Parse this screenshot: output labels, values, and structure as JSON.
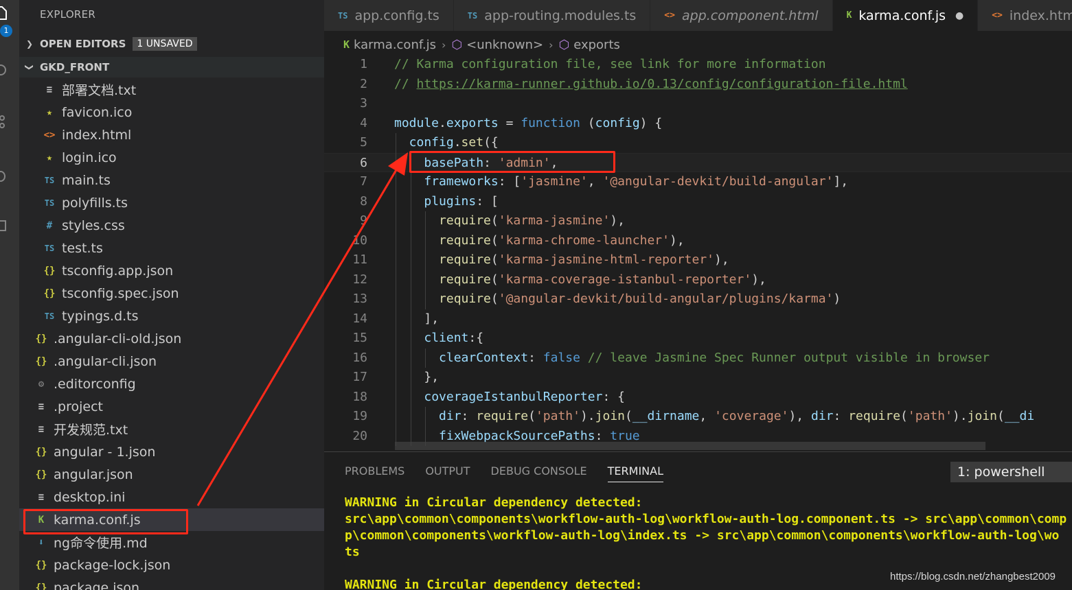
{
  "activity_bar": {
    "badge": "1",
    "icons": [
      "files-icon",
      "search-icon",
      "source-control-icon",
      "debug-icon",
      "extensions-icon"
    ]
  },
  "sidebar": {
    "title": "EXPLORER",
    "open_editors": {
      "label": "OPEN EDITORS",
      "badge": "1 UNSAVED"
    },
    "project": {
      "label": "GKD_FRONT"
    },
    "items": [
      {
        "label": "部署文档.txt",
        "icon": "txt-file-icon",
        "glyph": "≡",
        "type": "txt",
        "indent": 2
      },
      {
        "label": "favicon.ico",
        "icon": "star-file-icon",
        "glyph": "★",
        "type": "star",
        "indent": 2
      },
      {
        "label": "index.html",
        "icon": "html-file-icon",
        "glyph": "<>",
        "type": "html",
        "indent": 2
      },
      {
        "label": "login.ico",
        "icon": "star-file-icon",
        "glyph": "★",
        "type": "star",
        "indent": 2
      },
      {
        "label": "main.ts",
        "icon": "ts-file-icon",
        "glyph": "TS",
        "type": "ts",
        "indent": 2
      },
      {
        "label": "polyfills.ts",
        "icon": "ts-file-icon",
        "glyph": "TS",
        "type": "ts",
        "indent": 2
      },
      {
        "label": "styles.css",
        "icon": "css-file-icon",
        "glyph": "#",
        "type": "css",
        "indent": 2
      },
      {
        "label": "test.ts",
        "icon": "ts-file-icon",
        "glyph": "TS",
        "type": "ts",
        "indent": 2
      },
      {
        "label": "tsconfig.app.json",
        "icon": "json-file-icon",
        "glyph": "{}",
        "type": "json",
        "indent": 2
      },
      {
        "label": "tsconfig.spec.json",
        "icon": "json-file-icon",
        "glyph": "{}",
        "type": "json",
        "indent": 2
      },
      {
        "label": "typings.d.ts",
        "icon": "ts-file-icon",
        "glyph": "TS",
        "type": "ts",
        "indent": 2
      },
      {
        "label": ".angular-cli-old.json",
        "icon": "json-file-icon",
        "glyph": "{}",
        "type": "json",
        "indent": 1
      },
      {
        "label": ".angular-cli.json",
        "icon": "json-file-icon",
        "glyph": "{}",
        "type": "json",
        "indent": 1
      },
      {
        "label": ".editorconfig",
        "icon": "gear-file-icon",
        "glyph": "⚙",
        "type": "gear",
        "indent": 1
      },
      {
        "label": ".project",
        "icon": "txt-file-icon",
        "glyph": "≡",
        "type": "txt",
        "indent": 1
      },
      {
        "label": "开发规范.txt",
        "icon": "txt-file-icon",
        "glyph": "≡",
        "type": "txt",
        "indent": 1
      },
      {
        "label": "angular - 1.json",
        "icon": "json-file-icon",
        "glyph": "{}",
        "type": "json",
        "indent": 1
      },
      {
        "label": "angular.json",
        "icon": "json-file-icon",
        "glyph": "{}",
        "type": "json",
        "indent": 1
      },
      {
        "label": "desktop.ini",
        "icon": "txt-file-icon",
        "glyph": "≡",
        "type": "txt",
        "indent": 1
      },
      {
        "label": "karma.conf.js",
        "icon": "karma-file-icon",
        "glyph": "K",
        "type": "karma",
        "indent": 1,
        "selected": true
      },
      {
        "label": "ng命令使用.md",
        "icon": "markdown-file-icon",
        "glyph": "⬇",
        "type": "md",
        "indent": 1
      },
      {
        "label": "package-lock.json",
        "icon": "json-file-icon",
        "glyph": "{}",
        "type": "json",
        "indent": 1
      },
      {
        "label": "package.json",
        "icon": "json-file-icon",
        "glyph": "{}",
        "type": "json",
        "indent": 1
      }
    ]
  },
  "tabs": [
    {
      "label": "app.config.ts",
      "glyph": "TS",
      "type": "ts",
      "active": false
    },
    {
      "label": "app-routing.modules.ts",
      "glyph": "TS",
      "type": "ts",
      "active": false
    },
    {
      "label": "app.component.html",
      "glyph": "<>",
      "type": "html",
      "active": false,
      "italic": true
    },
    {
      "label": "karma.conf.js",
      "glyph": "K",
      "type": "karma",
      "active": true,
      "unsaved": true
    },
    {
      "label": "index.htm",
      "glyph": "<>",
      "type": "html",
      "active": false
    }
  ],
  "breadcrumb": {
    "file": "karma.conf.js",
    "symbol1": "<unknown>",
    "symbol2": "exports"
  },
  "editor": {
    "current_line": 6,
    "lines": [
      {
        "n": "1",
        "indent": 0,
        "tokens": [
          [
            "com",
            "// Karma configuration file, see link for more information"
          ]
        ]
      },
      {
        "n": "2",
        "indent": 0,
        "tokens": [
          [
            "com",
            "// "
          ],
          [
            "link",
            "https://karma-runner.github.io/0.13/config/configuration-file.html"
          ]
        ]
      },
      {
        "n": "3",
        "indent": 0,
        "tokens": []
      },
      {
        "n": "4",
        "indent": 0,
        "tokens": [
          [
            "var",
            "module"
          ],
          [
            "txt",
            "."
          ],
          [
            "var",
            "exports"
          ],
          [
            "txt",
            " = "
          ],
          [
            "kw",
            "function"
          ],
          [
            "txt",
            " ("
          ],
          [
            "var",
            "config"
          ],
          [
            "txt",
            ") {"
          ]
        ]
      },
      {
        "n": "5",
        "indent": 1,
        "tokens": [
          [
            "var",
            "config"
          ],
          [
            "txt",
            "."
          ],
          [
            "fn",
            "set"
          ],
          [
            "txt",
            "({"
          ]
        ]
      },
      {
        "n": "6",
        "indent": 2,
        "tokens": [
          [
            "var",
            "basePath"
          ],
          [
            "txt",
            ": "
          ],
          [
            "str",
            "'admin'"
          ],
          [
            "txt",
            ","
          ]
        ]
      },
      {
        "n": "7",
        "indent": 2,
        "tokens": [
          [
            "var",
            "frameworks"
          ],
          [
            "txt",
            ": ["
          ],
          [
            "str",
            "'jasmine'"
          ],
          [
            "txt",
            ", "
          ],
          [
            "str",
            "'@angular-devkit/build-angular'"
          ],
          [
            "txt",
            "],"
          ]
        ]
      },
      {
        "n": "8",
        "indent": 2,
        "tokens": [
          [
            "var",
            "plugins"
          ],
          [
            "txt",
            ": ["
          ]
        ]
      },
      {
        "n": "9",
        "indent": 3,
        "tokens": [
          [
            "fn",
            "require"
          ],
          [
            "txt",
            "("
          ],
          [
            "str",
            "'karma-jasmine'"
          ],
          [
            "txt",
            "),"
          ]
        ]
      },
      {
        "n": "10",
        "indent": 3,
        "tokens": [
          [
            "fn",
            "require"
          ],
          [
            "txt",
            "("
          ],
          [
            "str",
            "'karma-chrome-launcher'"
          ],
          [
            "txt",
            "),"
          ]
        ]
      },
      {
        "n": "11",
        "indent": 3,
        "tokens": [
          [
            "fn",
            "require"
          ],
          [
            "txt",
            "("
          ],
          [
            "str",
            "'karma-jasmine-html-reporter'"
          ],
          [
            "txt",
            "),"
          ]
        ]
      },
      {
        "n": "12",
        "indent": 3,
        "tokens": [
          [
            "fn",
            "require"
          ],
          [
            "txt",
            "("
          ],
          [
            "str",
            "'karma-coverage-istanbul-reporter'"
          ],
          [
            "txt",
            "),"
          ]
        ]
      },
      {
        "n": "13",
        "indent": 3,
        "tokens": [
          [
            "fn",
            "require"
          ],
          [
            "txt",
            "("
          ],
          [
            "str",
            "'@angular-devkit/build-angular/plugins/karma'"
          ],
          [
            "txt",
            ")"
          ]
        ]
      },
      {
        "n": "14",
        "indent": 2,
        "tokens": [
          [
            "txt",
            "],"
          ]
        ]
      },
      {
        "n": "15",
        "indent": 2,
        "tokens": [
          [
            "var",
            "client"
          ],
          [
            "txt",
            ":{"
          ]
        ]
      },
      {
        "n": "16",
        "indent": 3,
        "tokens": [
          [
            "var",
            "clearContext"
          ],
          [
            "txt",
            ": "
          ],
          [
            "kw",
            "false"
          ],
          [
            "txt",
            " "
          ],
          [
            "com",
            "// leave Jasmine Spec Runner output visible in browser"
          ]
        ]
      },
      {
        "n": "17",
        "indent": 2,
        "tokens": [
          [
            "txt",
            "},"
          ]
        ]
      },
      {
        "n": "18",
        "indent": 2,
        "tokens": [
          [
            "var",
            "coverageIstanbulReporter"
          ],
          [
            "txt",
            ": {"
          ]
        ]
      },
      {
        "n": "19",
        "indent": 3,
        "tokens": [
          [
            "var",
            "dir"
          ],
          [
            "txt",
            ": "
          ],
          [
            "fn",
            "require"
          ],
          [
            "txt",
            "("
          ],
          [
            "str",
            "'path'"
          ],
          [
            "txt",
            ")."
          ],
          [
            "fn",
            "join"
          ],
          [
            "txt",
            "("
          ],
          [
            "var",
            "__dirname"
          ],
          [
            "txt",
            ", "
          ],
          [
            "str",
            "'coverage'"
          ],
          [
            "txt",
            "), "
          ],
          [
            "var",
            "dir"
          ],
          [
            "txt",
            ": "
          ],
          [
            "fn",
            "require"
          ],
          [
            "txt",
            "("
          ],
          [
            "str",
            "'path'"
          ],
          [
            "txt",
            ")."
          ],
          [
            "fn",
            "join"
          ],
          [
            "txt",
            "("
          ],
          [
            "var",
            "__di"
          ]
        ]
      },
      {
        "n": "20",
        "indent": 3,
        "tokens": [
          [
            "var",
            "fixWebpackSourcePaths"
          ],
          [
            "txt",
            ": "
          ],
          [
            "kw",
            "true"
          ]
        ]
      }
    ]
  },
  "panel": {
    "tabs": [
      {
        "label": "PROBLEMS",
        "active": false
      },
      {
        "label": "OUTPUT",
        "active": false
      },
      {
        "label": "DEBUG CONSOLE",
        "active": false
      },
      {
        "label": "TERMINAL",
        "active": true
      }
    ],
    "terminal_selector": "1: powershell",
    "output": [
      "WARNING in Circular dependency detected:",
      "src\\app\\common\\components\\workflow-auth-log\\workflow-auth-log.component.ts -> src\\app\\common\\comp",
      "p\\common\\components\\workflow-auth-log\\index.ts -> src\\app\\common\\components\\workflow-auth-log\\wo",
      "ts",
      "",
      "WARNING in Circular dependency detected:"
    ]
  },
  "watermark": "https://blog.csdn.net/zhangbest2009",
  "colors": {
    "annotation_red": "#ff2a1a",
    "accent_blue": "#0e70c0"
  }
}
